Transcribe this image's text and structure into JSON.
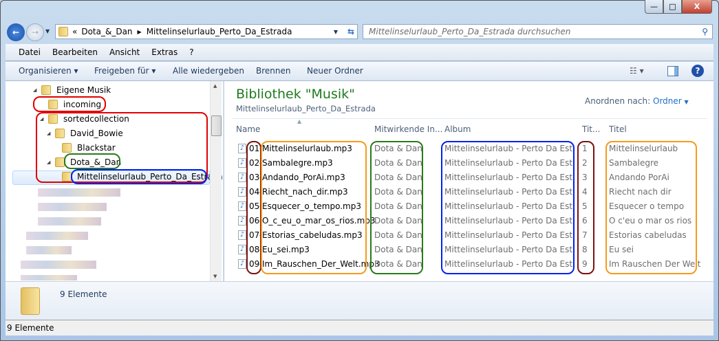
{
  "window": {
    "minimize": "—",
    "maximize": "□",
    "close": "X"
  },
  "address": {
    "overflow": "«",
    "crumbs": [
      "Dota_&_Dan",
      "Mittelinselurlaub_Perto_Da_Estrada"
    ],
    "search_placeholder": "Mittelinselurlaub_Perto_Da_Estrada durchsuchen"
  },
  "menu": [
    "Datei",
    "Bearbeiten",
    "Ansicht",
    "Extras",
    "?"
  ],
  "toolbar": {
    "organize": "Organisieren ▾",
    "share": "Freigeben für ▾",
    "play_all": "Alle wiedergeben",
    "burn": "Brennen",
    "new_folder": "Neuer Ordner"
  },
  "tree": [
    {
      "label": "Eigene Musik",
      "level": 0,
      "expanded": true
    },
    {
      "label": "incoming",
      "level": 1
    },
    {
      "label": "sortedcollection",
      "level": 1,
      "expanded": true
    },
    {
      "label": "David_Bowie",
      "level": 2,
      "expanded": true
    },
    {
      "label": "Blackstar",
      "level": 3
    },
    {
      "label": "Dota_&_Dan",
      "level": 2,
      "expanded": true
    },
    {
      "label": "Mittelinselurlaub_Perto_Da_Estrada",
      "level": 3,
      "selected": true
    }
  ],
  "library": {
    "title": "Bibliothek \"Musik\"",
    "subtitle": "Mittelinselurlaub_Perto_Da_Estrada",
    "arrange_label": "Anordnen nach:",
    "arrange_value": "Ordner"
  },
  "columns": [
    "Name",
    "Mitwirkende In...",
    "Album",
    "Tit...",
    "Titel"
  ],
  "files": [
    {
      "prefix": "01",
      "name": "Mittelinselurlaub.mp3",
      "artist": "Dota & Dan",
      "album": "Mittelinselurlaub - Perto Da Estrada",
      "track": "1",
      "title": "Mittelinselurlaub"
    },
    {
      "prefix": "02",
      "name": "Sambalegre.mp3",
      "artist": "Dota & Dan",
      "album": "Mittelinselurlaub - Perto Da Estrada",
      "track": "2",
      "title": "Sambalegre"
    },
    {
      "prefix": "03",
      "name": "Andando_PorAi.mp3",
      "artist": "Dota & Dan",
      "album": "Mittelinselurlaub - Perto Da Estrada",
      "track": "3",
      "title": "Andando PorAi"
    },
    {
      "prefix": "04",
      "name": "Riecht_nach_dir.mp3",
      "artist": "Dota & Dan",
      "album": "Mittelinselurlaub - Perto Da Estrada",
      "track": "4",
      "title": "Riecht nach dir"
    },
    {
      "prefix": "05",
      "name": "Esquecer_o_tempo.mp3",
      "artist": "Dota & Dan",
      "album": "Mittelinselurlaub - Perto Da Estrada",
      "track": "5",
      "title": "Esquecer o tempo"
    },
    {
      "prefix": "06",
      "name": "O_c_eu_o_mar_os_rios.mp3",
      "artist": "Dota & Dan",
      "album": "Mittelinselurlaub - Perto Da Estrada",
      "track": "6",
      "title": "O c'eu o mar os rios"
    },
    {
      "prefix": "07",
      "name": "Estorias_cabeludas.mp3",
      "artist": "Dota & Dan",
      "album": "Mittelinselurlaub - Perto Da Estrada",
      "track": "7",
      "title": "Estorias cabeludas"
    },
    {
      "prefix": "08",
      "name": "Eu_sei.mp3",
      "artist": "Dota & Dan",
      "album": "Mittelinselurlaub - Perto Da Estrada",
      "track": "8",
      "title": "Eu sei"
    },
    {
      "prefix": "09",
      "name": "Im_Rauschen_Der_Welt.mp3",
      "artist": "Dota & Dan",
      "album": "Mittelinselurlaub - Perto Da Estrada",
      "track": "9",
      "title": "Im Rauschen Der Welt"
    }
  ],
  "details": {
    "count": "9 Elemente"
  },
  "status": {
    "count": "9 Elemente"
  },
  "colors": {
    "title_green": "#1e7a1e",
    "link_blue": "#1e6fc6",
    "ring_red": "#e00000",
    "ring_green": "#2a7a1a",
    "ring_blue": "#0022ee",
    "ring_orange": "#f59a1a",
    "ring_darkred": "#7a1010"
  }
}
